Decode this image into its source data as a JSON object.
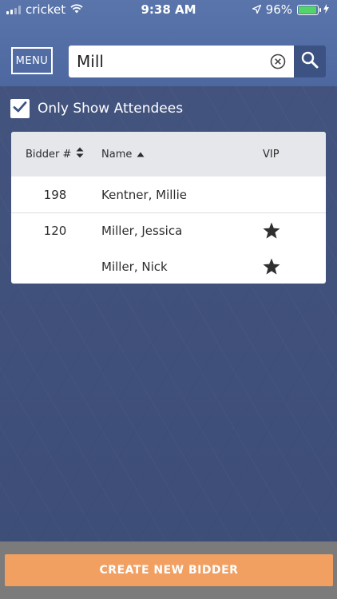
{
  "status_bar": {
    "carrier": "cricket",
    "time": "9:38 AM",
    "battery_percent": "96%",
    "battery_level": 0.96
  },
  "header": {
    "menu_label": "MENU",
    "search_value": "Mill",
    "search_icon": "magnifier-icon",
    "clear_icon": "clear-circle-x-icon"
  },
  "filter": {
    "only_attendees_label": "Only Show Attendees",
    "checked": true
  },
  "table": {
    "columns": {
      "bidder": "Bidder #",
      "name": "Name",
      "vip": "VIP"
    },
    "rows": [
      {
        "bidder": "198",
        "name": "Kentner, Millie",
        "vip": false
      },
      {
        "bidder": "120",
        "name": "Miller, Jessica",
        "vip": true
      },
      {
        "bidder": "",
        "name": "Miller, Nick",
        "vip": true
      }
    ]
  },
  "footer": {
    "create_label": "CREATE NEW BIDDER"
  },
  "colors": {
    "header_bg": "#5570a6",
    "body_bg": "#3f507c",
    "accent_button": "#f2a062",
    "search_button": "#3c5282"
  }
}
